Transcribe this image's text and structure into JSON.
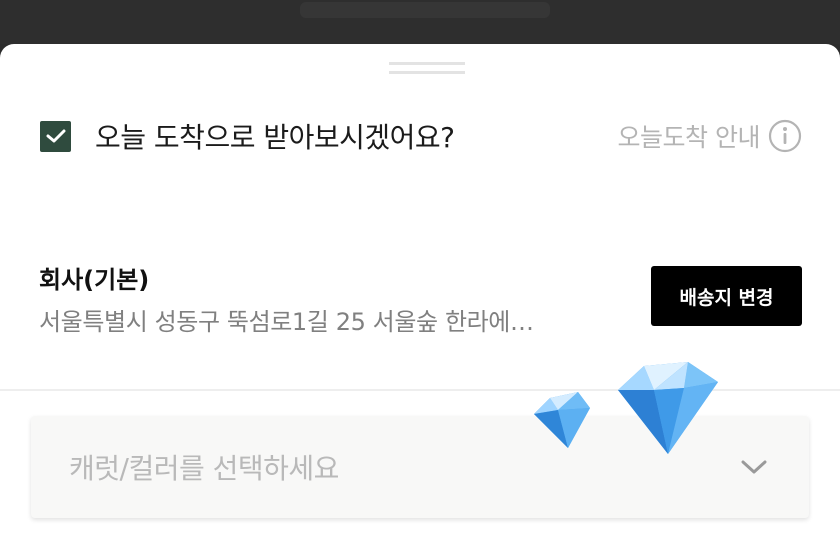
{
  "today_delivery": {
    "checked": true,
    "label": "오늘 도착으로 받아보시겠어요?",
    "info_label": "오늘도착 안내"
  },
  "address": {
    "name": "회사(기본)",
    "line": "서울특별시 성동구 뚝섬로1길 25 서울숲 한라에…",
    "change_button": "배송지 변경"
  },
  "option_select": {
    "placeholder": "캐럿/컬러를 선택하세요"
  },
  "colors": {
    "checkbox": "#2f4b3e",
    "button": "#000000",
    "muted_text": "#b4b4b4"
  },
  "icons": {
    "check": "check-icon",
    "info": "info-icon",
    "chevron": "chevron-down-icon",
    "gem": "diamond-icon"
  }
}
